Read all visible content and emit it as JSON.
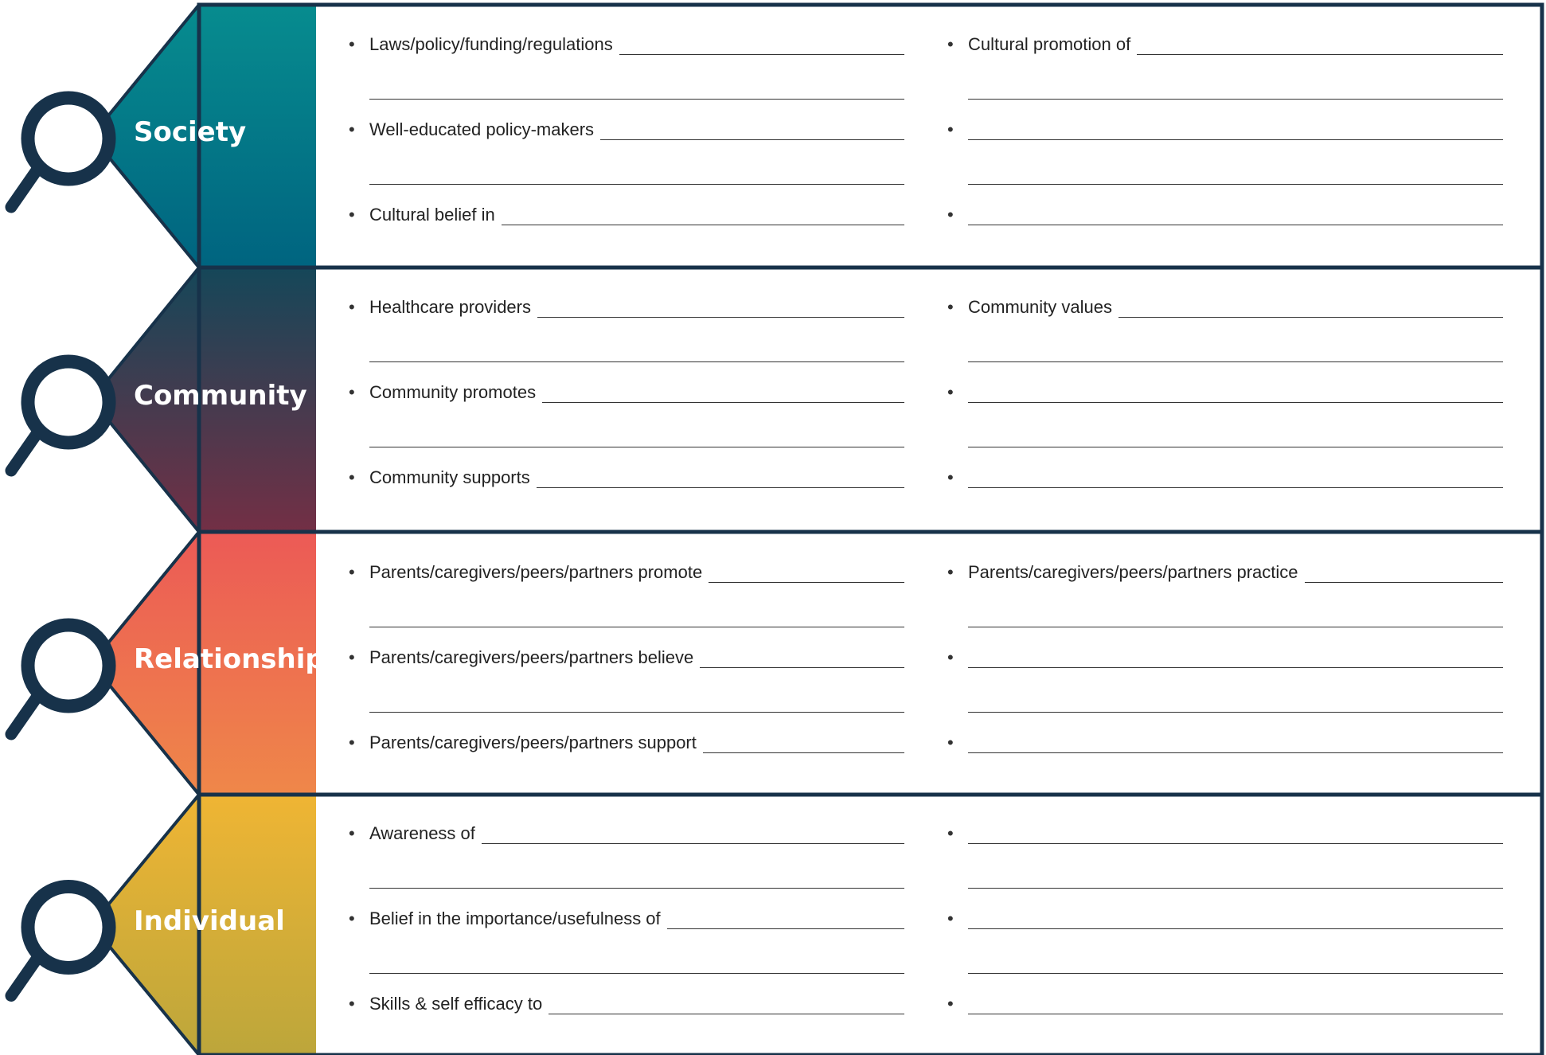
{
  "colors": {
    "frame": "#17324a",
    "underline": "#e8504f",
    "society": [
      "#078c8f",
      "#006480"
    ],
    "community": [
      "#154759",
      "#732f45"
    ],
    "relationship": [
      "#ec5a56",
      "#ef8749"
    ],
    "individual": [
      "#efb534",
      "#bca63b"
    ]
  },
  "icons": {
    "level_icon": "magnifying-glass-icon"
  },
  "levels": [
    {
      "id": "society",
      "label": "Society",
      "left": [
        "Laws/policy/funding/regulations",
        "Well-educated policy-makers",
        "Cultural belief in"
      ],
      "right": [
        "Cultural promotion of",
        "",
        ""
      ]
    },
    {
      "id": "community",
      "label": "Community",
      "left": [
        "Healthcare providers",
        "Community promotes",
        "Community supports"
      ],
      "right": [
        "Community values",
        "",
        ""
      ]
    },
    {
      "id": "relationship",
      "label": "Relationship",
      "left": [
        "Parents/caregivers/peers/partners promote",
        "Parents/caregivers/peers/partners believe",
        "Parents/caregivers/peers/partners support"
      ],
      "right": [
        "Parents/caregivers/peers/partners practice",
        "",
        ""
      ]
    },
    {
      "id": "individual",
      "label": "Individual",
      "left": [
        "Awareness of",
        "Belief in the importance/usefulness of",
        "Skills & self efficacy to"
      ],
      "right": [
        "",
        "",
        ""
      ]
    }
  ]
}
